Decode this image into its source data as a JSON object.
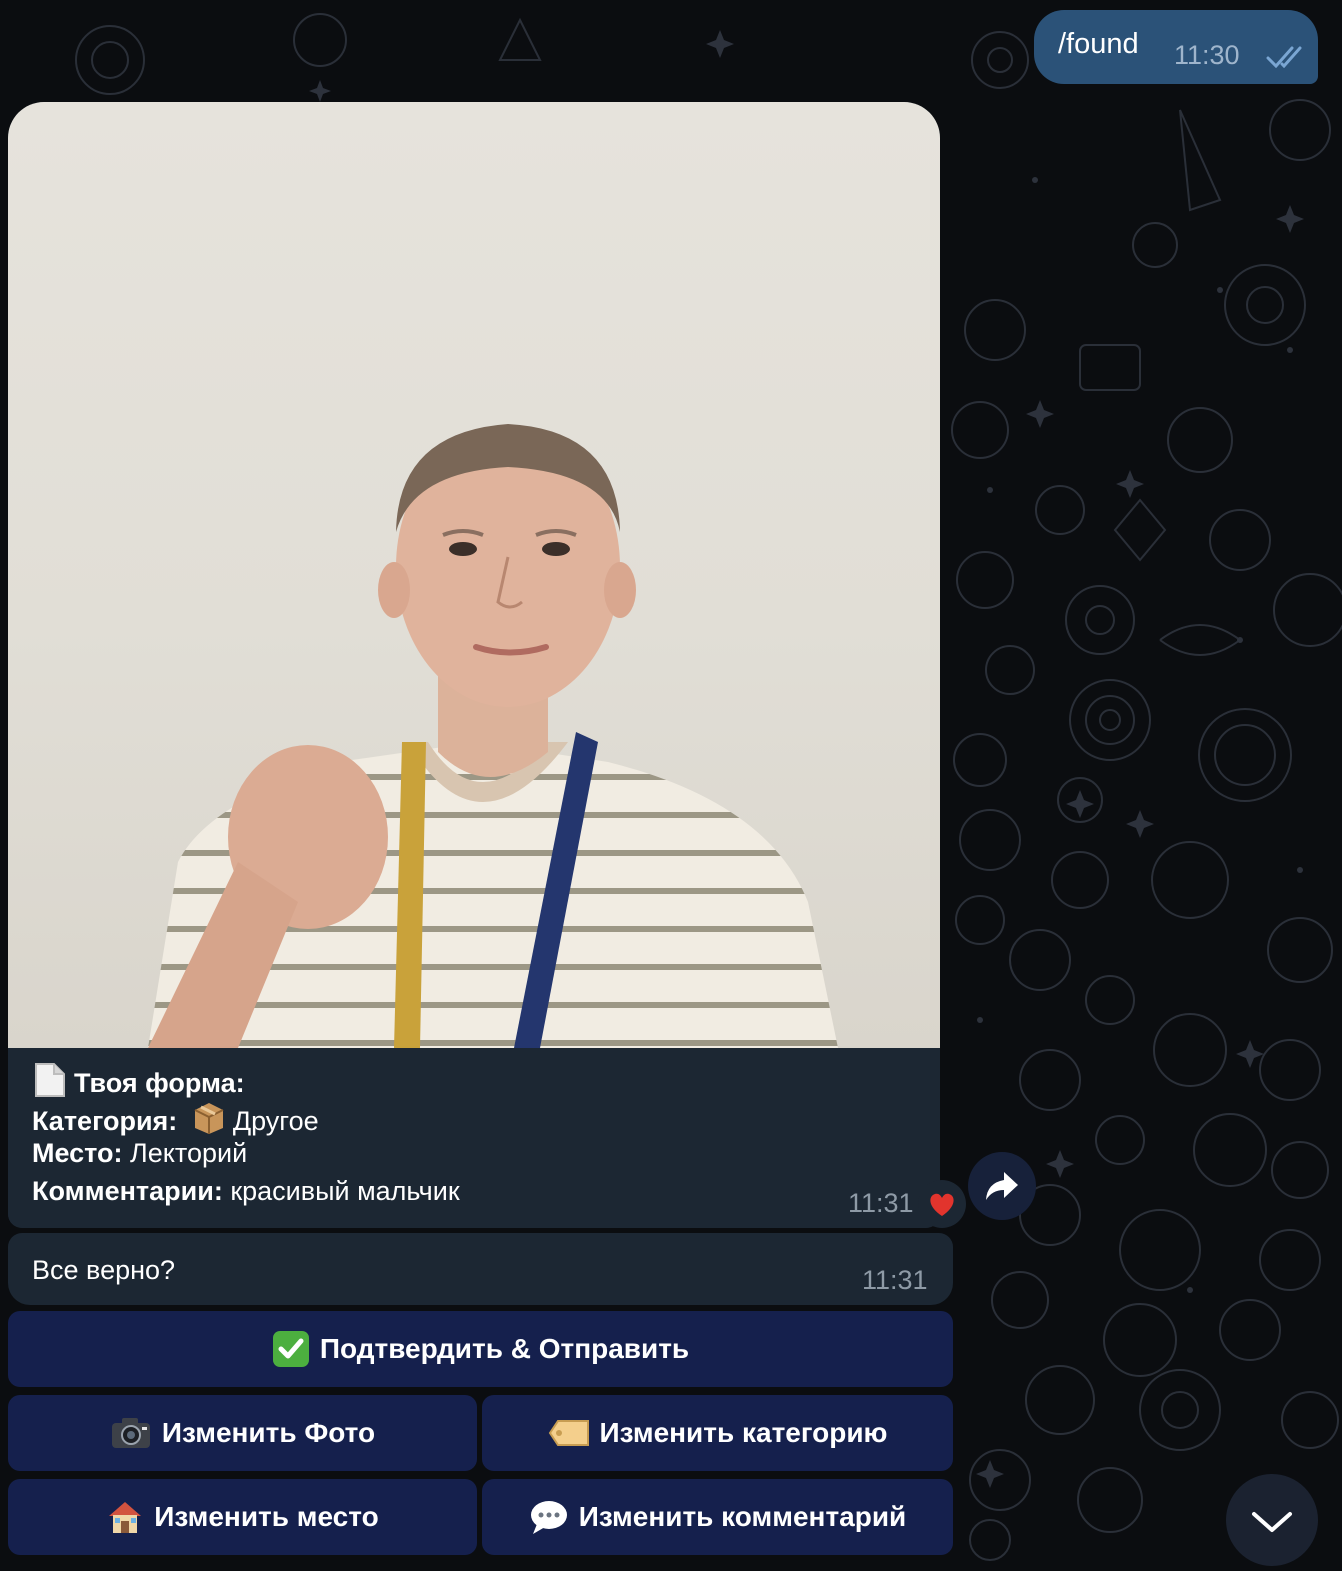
{
  "chat": {
    "outgoing": {
      "text": "/found",
      "time": "11:30",
      "status_icon": "double-check-icon"
    },
    "photo_message": {
      "photo_alt": "teenager with lanyard in striped t-shirt",
      "form_title": "Твоя форма:",
      "category_label": "Категория:",
      "category_value": "Другое",
      "place_label": "Место:",
      "place_value": "Лекторий",
      "comments_label": "Комментарии:",
      "comments_value": "красивый мальчик",
      "time": "11:31",
      "reaction": "heart-icon"
    },
    "confirm_message": {
      "text": "Все верно?",
      "time": "11:31"
    }
  },
  "keyboard": {
    "confirm": "Подтвердить & Отправить",
    "edit_photo": "Изменить Фото",
    "edit_category": "Изменить категорию",
    "edit_place": "Изменить место",
    "edit_comment": "Изменить комментарий"
  },
  "colors": {
    "background": "#0b0d10",
    "outgoing_bubble": "#2b5278",
    "incoming_bubble": "#1c2733",
    "keyboard_button": "#172252",
    "secondary_text": "#8e9aa6"
  }
}
